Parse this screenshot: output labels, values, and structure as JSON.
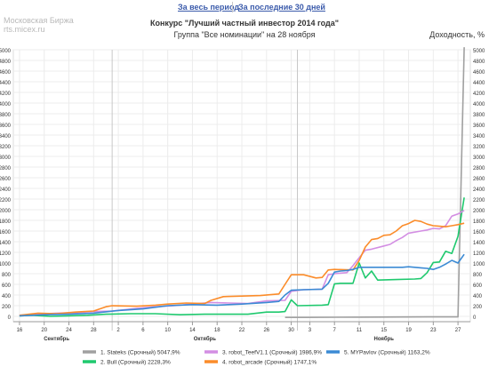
{
  "header": {
    "period_all": "За весь период",
    "period_30": "За последние 30 дней"
  },
  "watermark": {
    "line1": "Московская Биржа",
    "line2": "rts.micex.ru"
  },
  "chart_data": {
    "type": "line",
    "title": "Конкурс \"Лучший частный инвестор 2014 года\"",
    "subtitle": "Группа \"Все номинации\" на 28 ноября",
    "ylabel": "Доходность, %",
    "ylim": [
      -100,
      5000
    ],
    "yticks": [
      0,
      200,
      400,
      600,
      800,
      1000,
      1200,
      1400,
      1600,
      1800,
      2000,
      2200,
      2400,
      2600,
      2800,
      3000,
      3200,
      3400,
      3600,
      3800,
      4000,
      4200,
      4400,
      4600,
      4800,
      5000
    ],
    "xlim": [
      -1,
      73
    ],
    "xticks": [
      {
        "x": 0,
        "label": "16"
      },
      {
        "x": 4,
        "label": "20"
      },
      {
        "x": 8,
        "label": "24"
      },
      {
        "x": 12,
        "label": "28"
      },
      {
        "x": 16,
        "label": "2"
      },
      {
        "x": 20,
        "label": "6"
      },
      {
        "x": 24,
        "label": "10"
      },
      {
        "x": 28,
        "label": "14"
      },
      {
        "x": 32,
        "label": "18"
      },
      {
        "x": 36,
        "label": "22"
      },
      {
        "x": 40,
        "label": "26"
      },
      {
        "x": 44,
        "label": "30"
      },
      {
        "x": 47,
        "label": "3"
      },
      {
        "x": 51,
        "label": "7"
      },
      {
        "x": 55,
        "label": "11"
      },
      {
        "x": 59,
        "label": "15"
      },
      {
        "x": 63,
        "label": "19"
      },
      {
        "x": 67,
        "label": "23"
      },
      {
        "x": 71,
        "label": "27"
      }
    ],
    "month_labels": [
      {
        "x": 6,
        "label": "Сентябрь"
      },
      {
        "x": 30,
        "label": "Октябрь"
      },
      {
        "x": 59,
        "label": "Ноябрь"
      }
    ],
    "month_dividers": [
      15,
      45
    ],
    "grid": true,
    "legend_position": "bottom",
    "series": [
      {
        "name": "1. Stateks (Срочный)",
        "value_label": "5047,9%",
        "color": "#a0a0a0",
        "points": [
          [
            43,
            -20
          ],
          [
            46,
            -20
          ],
          [
            55,
            -15
          ],
          [
            66,
            -10
          ],
          [
            71,
            -10
          ],
          [
            72,
            5047.9
          ]
        ]
      },
      {
        "name": "2. Bull (Срочный)",
        "value_label": "2228,3%",
        "color": "#1fc96e",
        "points": [
          [
            0,
            10
          ],
          [
            2,
            20
          ],
          [
            5,
            0
          ],
          [
            8,
            10
          ],
          [
            11,
            20
          ],
          [
            14,
            40
          ],
          [
            18,
            50
          ],
          [
            22,
            50
          ],
          [
            26,
            30
          ],
          [
            30,
            40
          ],
          [
            34,
            40
          ],
          [
            37,
            40
          ],
          [
            40,
            80
          ],
          [
            42,
            80
          ],
          [
            43,
            90
          ],
          [
            44,
            310
          ],
          [
            45,
            200
          ],
          [
            49,
            210
          ],
          [
            50,
            220
          ],
          [
            51,
            610
          ],
          [
            52,
            620
          ],
          [
            54,
            620
          ],
          [
            55,
            1000
          ],
          [
            56,
            720
          ],
          [
            57,
            850
          ],
          [
            58,
            680
          ],
          [
            61,
            690
          ],
          [
            64,
            700
          ],
          [
            65,
            710
          ],
          [
            66,
            820
          ],
          [
            67,
            1010
          ],
          [
            68,
            1020
          ],
          [
            69,
            1220
          ],
          [
            70,
            1180
          ],
          [
            71,
            1500
          ],
          [
            72,
            2228.3
          ]
        ]
      },
      {
        "name": "3. robot_TeefV1.1 (Срочный)",
        "value_label": "1986,9%",
        "color": "#d38ee3",
        "points": [
          [
            0,
            20
          ],
          [
            3,
            40
          ],
          [
            6,
            60
          ],
          [
            9,
            70
          ],
          [
            12,
            90
          ],
          [
            15,
            100
          ],
          [
            19,
            150
          ],
          [
            22,
            180
          ],
          [
            25,
            200
          ],
          [
            28,
            230
          ],
          [
            31,
            260
          ],
          [
            34,
            250
          ],
          [
            37,
            240
          ],
          [
            40,
            290
          ],
          [
            43,
            300
          ],
          [
            44,
            470
          ],
          [
            46,
            500
          ],
          [
            49,
            510
          ],
          [
            50,
            780
          ],
          [
            51,
            800
          ],
          [
            53,
            820
          ],
          [
            54,
            950
          ],
          [
            55,
            1100
          ],
          [
            56,
            1240
          ],
          [
            57,
            1260
          ],
          [
            59,
            1320
          ],
          [
            60,
            1350
          ],
          [
            61,
            1420
          ],
          [
            62,
            1480
          ],
          [
            63,
            1560
          ],
          [
            65,
            1600
          ],
          [
            66,
            1620
          ],
          [
            67,
            1650
          ],
          [
            68,
            1640
          ],
          [
            69,
            1700
          ],
          [
            70,
            1880
          ],
          [
            71,
            1920
          ],
          [
            72,
            1986.9
          ]
        ]
      },
      {
        "name": "4. robot_arcade (Срочный)",
        "value_label": "1747,1%",
        "color": "#fb8c2a",
        "points": [
          [
            0,
            20
          ],
          [
            3,
            60
          ],
          [
            6,
            50
          ],
          [
            9,
            80
          ],
          [
            12,
            100
          ],
          [
            14,
            180
          ],
          [
            15,
            200
          ],
          [
            19,
            190
          ],
          [
            22,
            210
          ],
          [
            24,
            230
          ],
          [
            27,
            250
          ],
          [
            30,
            240
          ],
          [
            31,
            300
          ],
          [
            33,
            370
          ],
          [
            36,
            380
          ],
          [
            39,
            390
          ],
          [
            42,
            420
          ],
          [
            43,
            600
          ],
          [
            44,
            780
          ],
          [
            46,
            780
          ],
          [
            48,
            720
          ],
          [
            49,
            730
          ],
          [
            50,
            870
          ],
          [
            51,
            880
          ],
          [
            54,
            870
          ],
          [
            55,
            1050
          ],
          [
            56,
            1300
          ],
          [
            57,
            1440
          ],
          [
            58,
            1460
          ],
          [
            59,
            1520
          ],
          [
            60,
            1530
          ],
          [
            61,
            1600
          ],
          [
            62,
            1700
          ],
          [
            63,
            1740
          ],
          [
            64,
            1800
          ],
          [
            65,
            1780
          ],
          [
            66,
            1730
          ],
          [
            67,
            1700
          ],
          [
            68,
            1690
          ],
          [
            69,
            1680
          ],
          [
            70,
            1700
          ],
          [
            71,
            1720
          ],
          [
            72,
            1747.1
          ]
        ]
      },
      {
        "name": "5. MYPavlov (Срочный)",
        "value_label": "1163,2%",
        "color": "#3b8ad4",
        "points": [
          [
            0,
            10
          ],
          [
            4,
            30
          ],
          [
            8,
            40
          ],
          [
            12,
            60
          ],
          [
            16,
            110
          ],
          [
            20,
            140
          ],
          [
            24,
            200
          ],
          [
            28,
            220
          ],
          [
            32,
            210
          ],
          [
            36,
            230
          ],
          [
            40,
            260
          ],
          [
            42,
            280
          ],
          [
            43,
            400
          ],
          [
            44,
            490
          ],
          [
            46,
            500
          ],
          [
            49,
            510
          ],
          [
            50,
            620
          ],
          [
            51,
            830
          ],
          [
            52,
            850
          ],
          [
            53,
            860
          ],
          [
            54,
            880
          ],
          [
            55,
            920
          ],
          [
            57,
            920
          ],
          [
            60,
            920
          ],
          [
            62,
            920
          ],
          [
            63,
            930
          ],
          [
            65,
            910
          ],
          [
            66,
            900
          ],
          [
            67,
            880
          ],
          [
            68,
            920
          ],
          [
            69,
            980
          ],
          [
            70,
            1050
          ],
          [
            71,
            1000
          ],
          [
            72,
            1163.2
          ]
        ]
      }
    ]
  }
}
